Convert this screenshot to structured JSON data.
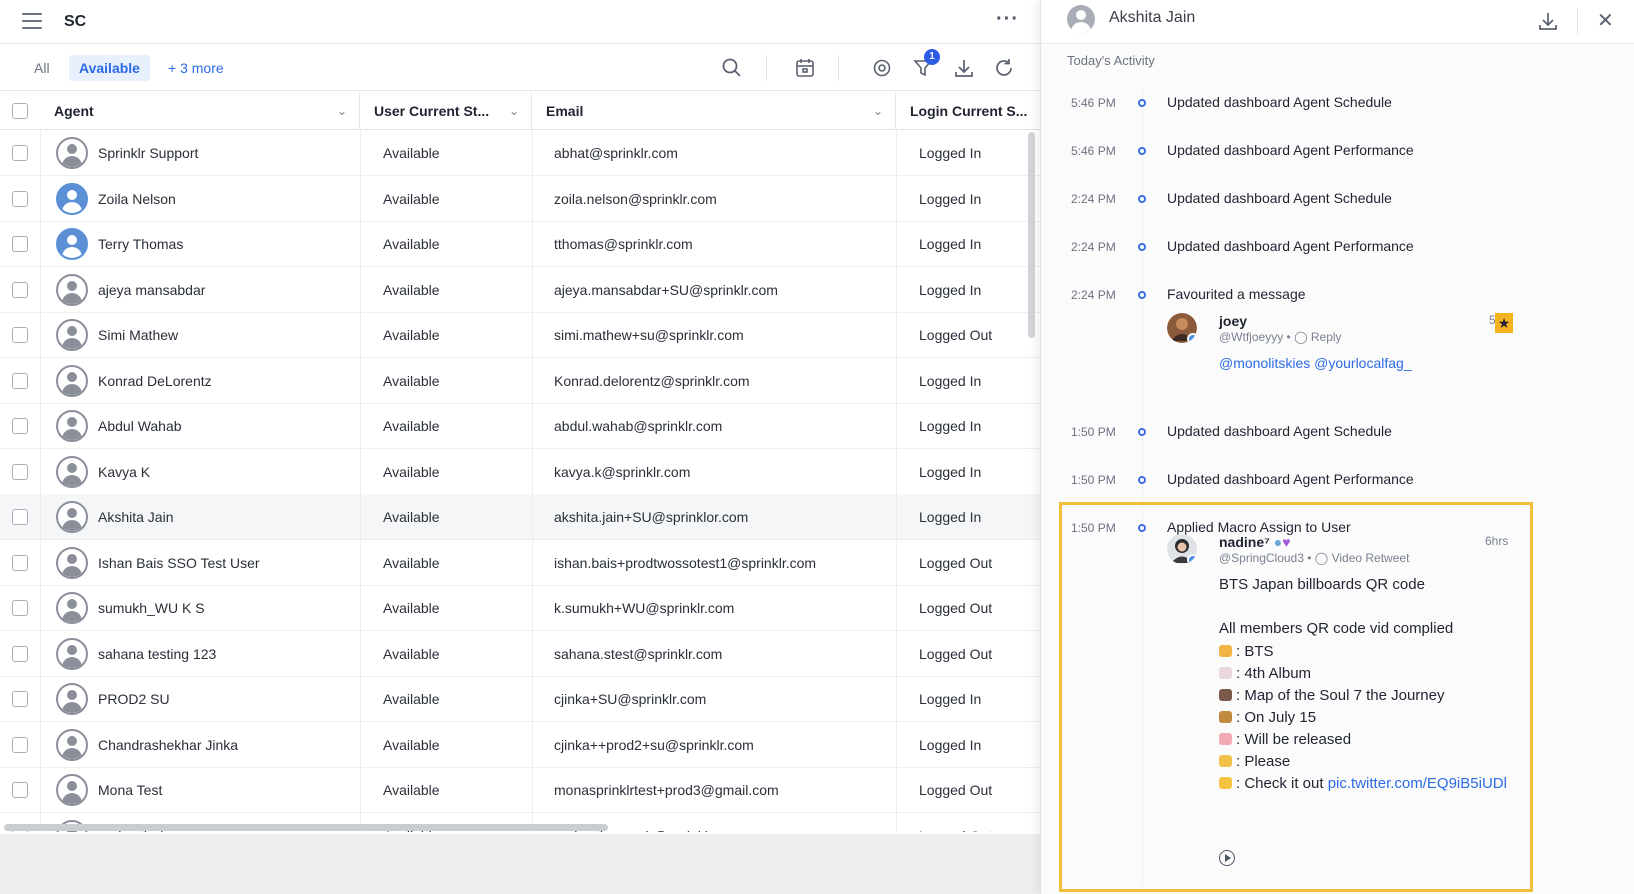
{
  "app": {
    "title": "SC",
    "more_label": "···"
  },
  "filters": {
    "all": "All",
    "available": "Available",
    "more": "+ 3 more"
  },
  "colors": {
    "accent": "#2d6be4",
    "highlight_border": "#f0bf3a"
  },
  "toolbar": {
    "filter_badge": "1"
  },
  "table": {
    "columns": [
      "Agent",
      "User Current St...",
      "Email",
      "Login Current S..."
    ],
    "rows": [
      {
        "agent": "Sprinklr Support",
        "status": "Available",
        "email": "abhat@sprinklr.com",
        "login": "Logged In"
      },
      {
        "agent": "Zoila Nelson",
        "status": "Available",
        "email": "zoila.nelson@sprinklr.com",
        "login": "Logged In"
      },
      {
        "agent": "Terry Thomas",
        "status": "Available",
        "email": "tthomas@sprinklr.com",
        "login": "Logged In"
      },
      {
        "agent": "ajeya mansabdar",
        "status": "Available",
        "email": "ajeya.mansabdar+SU@sprinklr.com",
        "login": "Logged In"
      },
      {
        "agent": "Simi Mathew",
        "status": "Available",
        "email": "simi.mathew+su@sprinklr.com",
        "login": "Logged Out"
      },
      {
        "agent": "Konrad DeLorentz",
        "status": "Available",
        "email": "Konrad.delorentz@sprinklr.com",
        "login": "Logged In"
      },
      {
        "agent": "Abdul Wahab",
        "status": "Available",
        "email": "abdul.wahab@sprinklr.com",
        "login": "Logged In"
      },
      {
        "agent": "Kavya K",
        "status": "Available",
        "email": "kavya.k@sprinklr.com",
        "login": "Logged In"
      },
      {
        "agent": "Akshita Jain",
        "status": "Available",
        "email": "akshita.jain+SU@sprinklor.com",
        "login": "Logged In"
      },
      {
        "agent": "Ishan Bais SSO Test User",
        "status": "Available",
        "email": "ishan.bais+prodtwossotest1@sprinklr.com",
        "login": "Logged Out"
      },
      {
        "agent": "sumukh_WU K S",
        "status": "Available",
        "email": "k.sumukh+WU@sprinklr.com",
        "login": "Logged Out"
      },
      {
        "agent": "sahana testing 123",
        "status": "Available",
        "email": "sahana.stest@sprinklr.com",
        "login": "Logged Out"
      },
      {
        "agent": "PROD2 SU",
        "status": "Available",
        "email": "cjinka+SU@sprinklr.com",
        "login": "Logged In"
      },
      {
        "agent": "Chandrashekhar Jinka",
        "status": "Available",
        "email": "cjinka++prod2+su@sprinklr.com",
        "login": "Logged In"
      },
      {
        "agent": "Mona Test",
        "status": "Available",
        "email": "monasprinklrtest+prod3@gmail.com",
        "login": "Logged Out"
      },
      {
        "agent": "prakyath d",
        "status": "Available",
        "email": "prakyath.p+wab@sprinklr.com",
        "login": "Logged Out"
      }
    ]
  },
  "panel": {
    "user_name": "Akshita Jain",
    "section_title": "Today's Activity",
    "activities": [
      {
        "time": "5:46 PM",
        "text": "Updated dashboard Agent Schedule"
      },
      {
        "time": "5:46 PM",
        "text": "Updated dashboard Agent Performance"
      },
      {
        "time": "2:24 PM",
        "text": "Updated dashboard Agent Schedule"
      },
      {
        "time": "2:24 PM",
        "text": "Updated dashboard Agent Performance"
      },
      {
        "time": "2:24 PM",
        "text": "Favourited a message"
      },
      {
        "time": "1:50 PM",
        "text": "Updated dashboard Agent Schedule"
      },
      {
        "time": "1:50 PM",
        "text": "Updated dashboard Agent Performance"
      },
      {
        "time": "1:50 PM",
        "text": "Applied Macro Assign to User"
      }
    ],
    "msg1": {
      "author": "joey",
      "handle": "@Wtfjoeyyy",
      "type": "Reply",
      "mentions": "@monolitskies @yourlocalfag_",
      "age": "5"
    },
    "msg2": {
      "author": "nadine⁷",
      "handle": "@SpringCloud3",
      "type": "Video Retweet",
      "age": "6hrs",
      "line1": "BTS Japan billboards QR code",
      "line2": "All members QR code vid complied",
      "items": [
        {
          "text": ": BTS",
          "color": "#f2b544"
        },
        {
          "text": ": 4th Album",
          "color": "#e9d6df"
        },
        {
          "text": ": Map of the Soul 7 the Journey",
          "color": "#7b5a4a"
        },
        {
          "text": ": On July 15",
          "color": "#c28a3c"
        },
        {
          "text": ": Will be released",
          "color": "#f3a9b5"
        },
        {
          "text": ": Please",
          "color": "#f0c24c"
        },
        {
          "text": ": Check it out ",
          "color": "#f5c542",
          "link": "pic.twitter.com/EQ9iB5iUDl"
        }
      ]
    }
  }
}
